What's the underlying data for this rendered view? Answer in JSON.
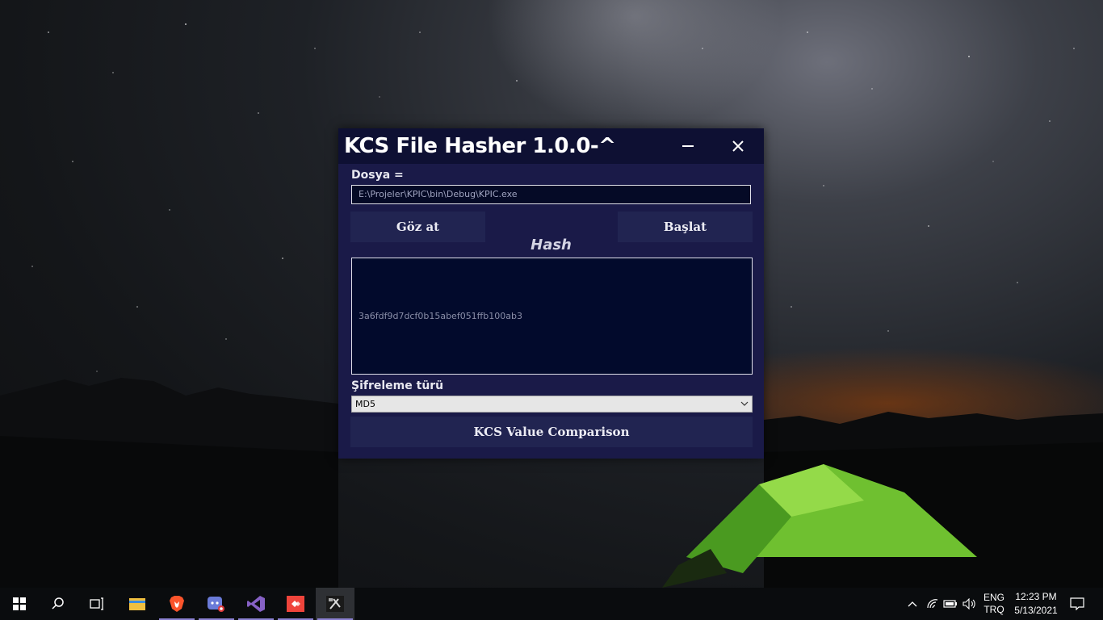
{
  "window": {
    "title": "KCS File Hasher 1.0.0-^",
    "minimize_icon": "minimize-icon",
    "close_icon": "close-icon"
  },
  "file": {
    "label": "Dosya =",
    "path": "E:\\Projeler\\KPIC\\bin\\Debug\\KPIC.exe"
  },
  "buttons": {
    "browse": "Göz at",
    "start": "Başlat",
    "compare": "KCS Value Comparison"
  },
  "hash": {
    "title": "Hash",
    "value": "3a6fdf9d7dcf0b15abef051ffb100ab3"
  },
  "encryption": {
    "label": "Şifreleme türü",
    "selected": "MD5"
  },
  "taskbar": {
    "apps": [
      "start-icon",
      "search-icon",
      "task-view-icon",
      "file-explorer-icon",
      "brave-browser-icon",
      "discord-icon",
      "visual-studio-icon",
      "anydesk-icon",
      "kcs-file-hasher-icon"
    ],
    "language_line1": "ENG",
    "language_line2": "TRQ",
    "time": "12:23 PM",
    "date": "5/13/2021"
  },
  "colors": {
    "window_bg": "#1a1a48",
    "titlebar_bg": "#0e1033",
    "button_bg": "#212451",
    "hash_box_bg": "#020a2c"
  }
}
